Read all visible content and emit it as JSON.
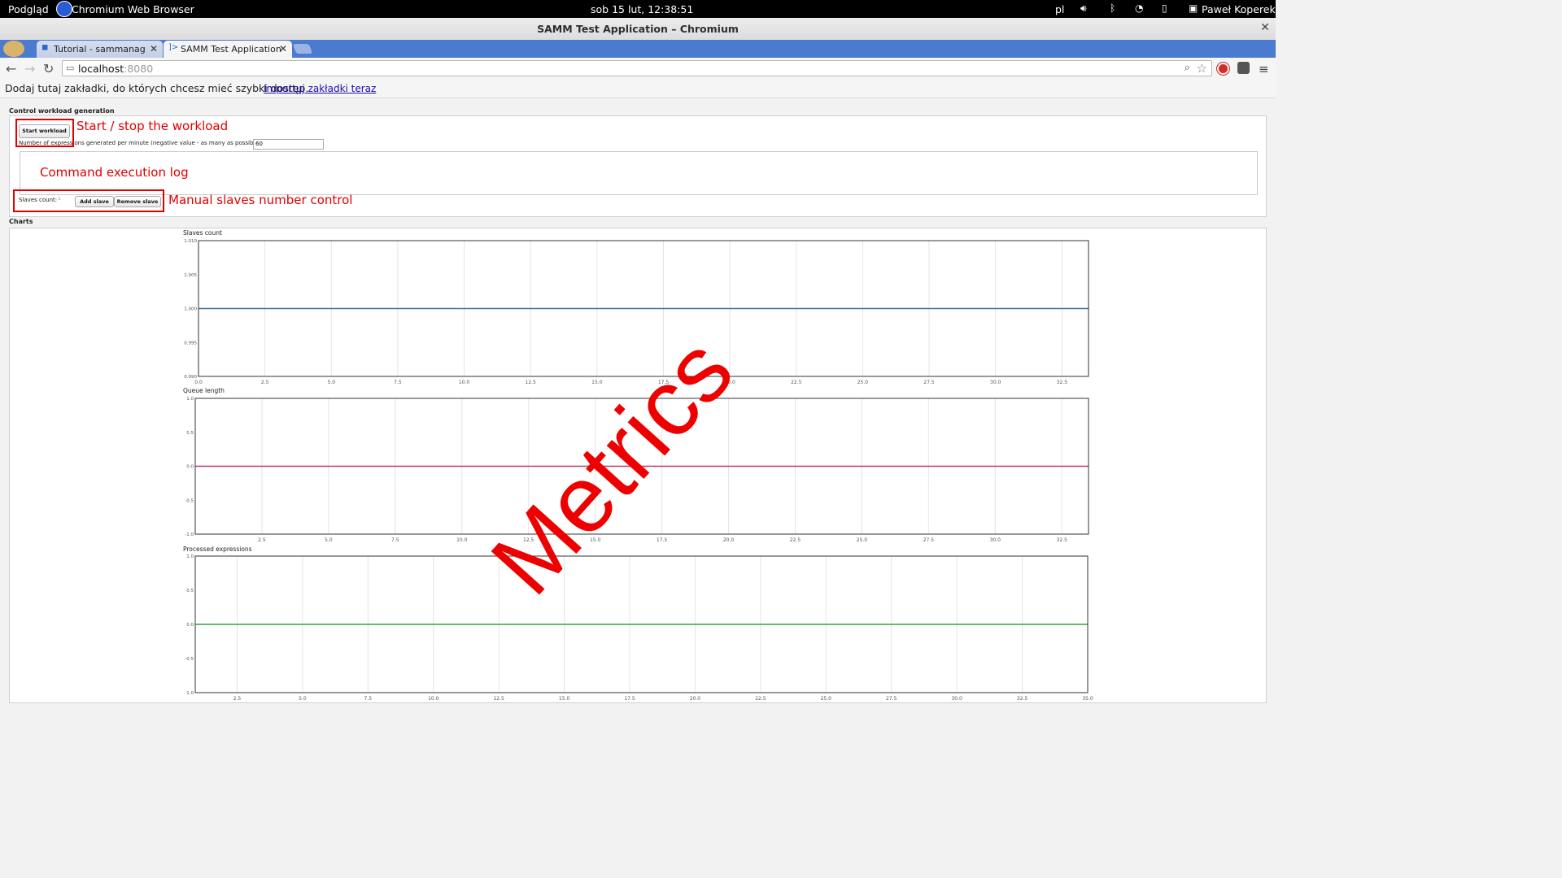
{
  "system_bar": {
    "activities_label": "Podgląd",
    "app_name": "Chromium Web Browser",
    "clock": "sob 15 lut, 12:38:51",
    "keyboard_layout": "pl",
    "user_name": "Paweł Koperek",
    "icons": [
      "volume-icon",
      "bluetooth-icon",
      "wifi-icon",
      "battery-icon",
      "user-icon"
    ]
  },
  "window": {
    "title": "SAMM Test Application – Chromium"
  },
  "tabs": [
    {
      "label": "Tutorial - sammanager - R",
      "active": false
    },
    {
      "label": "SAMM Test Application",
      "active": true
    }
  ],
  "toolbar": {
    "url_host": "localhost",
    "url_port": ":8080"
  },
  "bookmarks": {
    "message": "Dodaj tutaj zakładki, do których chcesz mieć szybki dostęp.",
    "import_link": "Importuj zakładki teraz"
  },
  "control": {
    "section_title": "Control workload generation",
    "start_button": "Start workload",
    "expressions_label": "Number of expressions generated per minute (negative value - as many as possible)",
    "expressions_value": "60",
    "slaves_label": "Slaves count:",
    "slaves_value": "1",
    "add_slave_button": "Add slave",
    "remove_slave_button": "Remove slave"
  },
  "annotations": {
    "start_stop": "Start / stop the workload",
    "command_log": "Command execution log",
    "manual_slaves": "Manual slaves number control",
    "metrics": "Metrics",
    "color": "#e00000"
  },
  "charts_section_title": "Charts",
  "chart_data": [
    {
      "type": "line",
      "title": "Slaves count",
      "xlim": [
        0,
        33.5
      ],
      "ylim": [
        0.99,
        1.01
      ],
      "x_ticks": [
        "0.0",
        "2.5",
        "5.0",
        "7.5",
        "10.0",
        "12.5",
        "15.0",
        "17.5",
        "20.0",
        "22.5",
        "25.0",
        "27.5",
        "30.0",
        "32.5"
      ],
      "y_ticks": [
        "1.010",
        "1.005",
        "1.000",
        "0.995",
        "0.990"
      ],
      "series": [
        {
          "x": [
            0,
            33.5
          ],
          "y": [
            1.0,
            1.0
          ],
          "color": "#4572a7"
        }
      ],
      "grid": true
    },
    {
      "type": "line",
      "title": "Queue length",
      "xlim": [
        0,
        33.5
      ],
      "ylim": [
        -1.0,
        1.0
      ],
      "x_ticks": [
        "2.5",
        "5.0",
        "7.5",
        "10.0",
        "12.5",
        "15.0",
        "17.5",
        "20.0",
        "22.5",
        "25.0",
        "27.5",
        "30.0",
        "32.5"
      ],
      "y_ticks": [
        "1.0",
        "0.5",
        "0.0",
        "-0.5",
        "-1.0"
      ],
      "series": [
        {
          "x": [
            0,
            33.5
          ],
          "y": [
            0,
            0
          ],
          "color": "#c0395a"
        }
      ],
      "grid": true
    },
    {
      "type": "line",
      "title": "Processed expressions",
      "xlim": [
        0.9,
        35.0
      ],
      "ylim": [
        -1.0,
        1.0
      ],
      "x_ticks": [
        "2.5",
        "5.0",
        "7.5",
        "10.0",
        "12.5",
        "15.0",
        "17.5",
        "20.0",
        "22.5",
        "25.0",
        "27.5",
        "30.0",
        "32.5",
        "35.0"
      ],
      "y_ticks": [
        "1.0",
        "0.5",
        "0.0",
        "-0.5",
        "-1.0"
      ],
      "series": [
        {
          "x": [
            0.9,
            35.0
          ],
          "y": [
            0,
            0
          ],
          "color": "#3aa040"
        }
      ],
      "grid": true
    }
  ]
}
